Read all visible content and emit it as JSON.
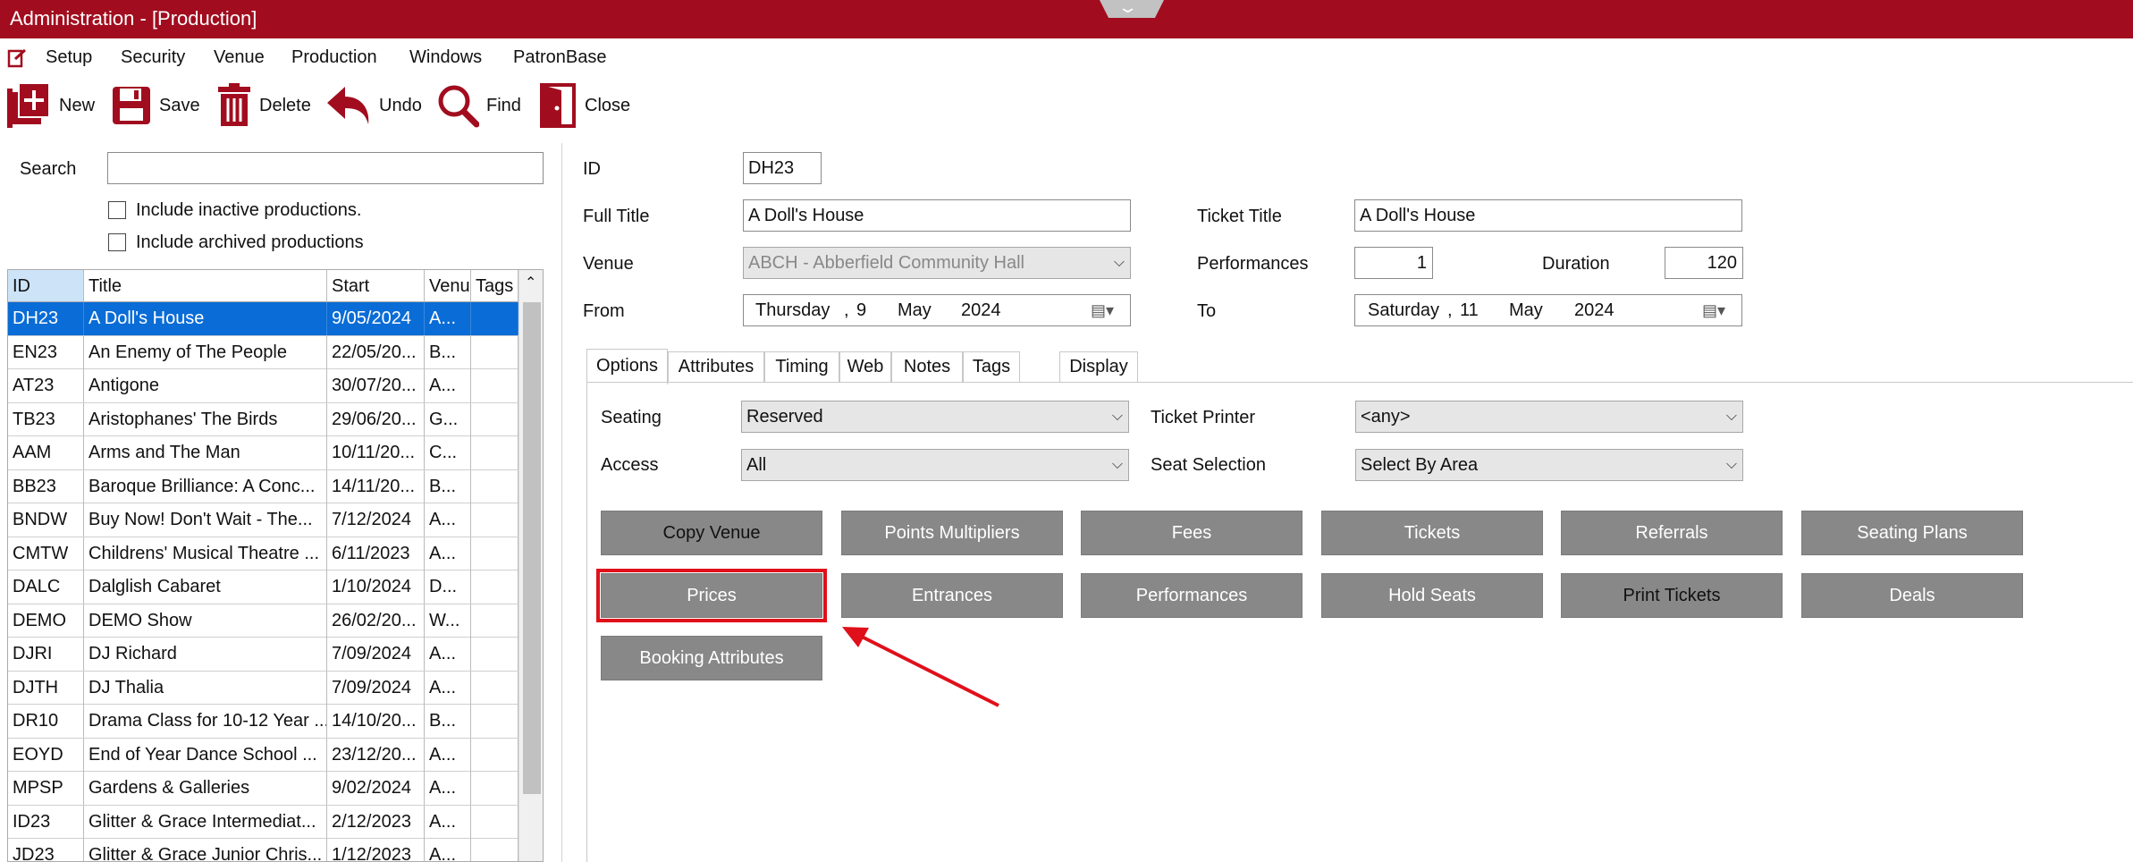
{
  "window": {
    "title": "Administration - [Production]"
  },
  "menu": [
    "Setup",
    "Security",
    "Venue",
    "Production",
    "Windows",
    "PatronBase"
  ],
  "toolbar": {
    "new": "New",
    "save": "Save",
    "delete": "Delete",
    "undo": "Undo",
    "find": "Find",
    "close": "Close"
  },
  "search": {
    "label": "Search",
    "value": "",
    "inactive_label": "Include inactive productions.",
    "archived_label": "Include archived productions",
    "inactive_checked": false,
    "archived_checked": false
  },
  "grid": {
    "headers": [
      "ID",
      "Title",
      "Start",
      "Venu",
      "Tags"
    ],
    "rows": [
      [
        "DH23",
        "A Doll's House",
        "9/05/2024",
        "A..."
      ],
      [
        "EN23",
        "An Enemy of The People",
        "22/05/20...",
        "B..."
      ],
      [
        "AT23",
        "Antigone",
        "30/07/20...",
        "A..."
      ],
      [
        "TB23",
        "Aristophanes' The Birds",
        "29/06/20...",
        "G..."
      ],
      [
        "AAM",
        "Arms and The Man",
        "10/11/20...",
        "C..."
      ],
      [
        "BB23",
        "Baroque Brilliance: A Conc...",
        "14/11/20...",
        "B..."
      ],
      [
        "BNDW",
        "Buy Now! Don't Wait - The...",
        "7/12/2024",
        "A..."
      ],
      [
        "CMTW",
        "Childrens' Musical Theatre ...",
        "6/11/2023",
        "A..."
      ],
      [
        "DALC",
        "Dalglish Cabaret",
        "1/10/2024",
        "D..."
      ],
      [
        "DEMO",
        "DEMO Show",
        "26/02/20...",
        "W..."
      ],
      [
        "DJRI",
        "DJ Richard",
        "7/09/2024",
        "A..."
      ],
      [
        "DJTH",
        "DJ Thalia",
        "7/09/2024",
        "A..."
      ],
      [
        "DR10",
        "Drama Class for 10-12 Year ...",
        "14/10/20...",
        "B..."
      ],
      [
        "EOYD",
        "End of Year Dance School ...",
        "23/12/20...",
        "A..."
      ],
      [
        "MPSP",
        "Gardens & Galleries",
        "9/02/2024",
        "A..."
      ],
      [
        "ID23",
        "Glitter & Grace Intermediat...",
        "2/12/2023",
        "A..."
      ],
      [
        "JD23",
        "Glitter & Grace Junior Chris...",
        "1/12/2023",
        "A..."
      ]
    ]
  },
  "form": {
    "id_label": "ID",
    "id": "DH23",
    "full_title_label": "Full Title",
    "full_title": "A Doll's House",
    "ticket_title_label": "Ticket Title",
    "ticket_title": "A Doll's House",
    "venue_label": "Venue",
    "venue": "ABCH - Abberfield Community Hall",
    "performances_label": "Performances",
    "performances": "1",
    "duration_label": "Duration",
    "duration": "120",
    "from_label": "From",
    "from_day": "Thursday",
    "from_date": "9",
    "from_month": "May",
    "from_year": "2024",
    "to_label": "To",
    "to_day": "Saturday",
    "to_date": "11",
    "to_month": "May",
    "to_year": "2024"
  },
  "tabs": [
    "Options",
    "Attributes",
    "Timing",
    "Web",
    "Notes",
    "Tags",
    "Display"
  ],
  "options": {
    "seating_label": "Seating",
    "seating": "Reserved",
    "ticket_printer_label": "Ticket Printer",
    "ticket_printer": "<any>",
    "access_label": "Access",
    "access": "All",
    "seat_selection_label": "Seat Selection",
    "seat_selection": "Select By Area"
  },
  "buttons": {
    "row1": [
      "Copy Venue",
      "Points Multipliers",
      "Fees",
      "Tickets",
      "Referrals",
      "Seating Plans"
    ],
    "row2": [
      "Prices",
      "Entrances",
      "Performances",
      "Hold Seats",
      "Print Tickets",
      "Deals"
    ],
    "row3": [
      "Booking Attributes"
    ]
  },
  "colors": {
    "titlebar": "#a10d1f",
    "selection": "#0a6cd6",
    "button": "#888888",
    "highlight": "#e0101a"
  }
}
